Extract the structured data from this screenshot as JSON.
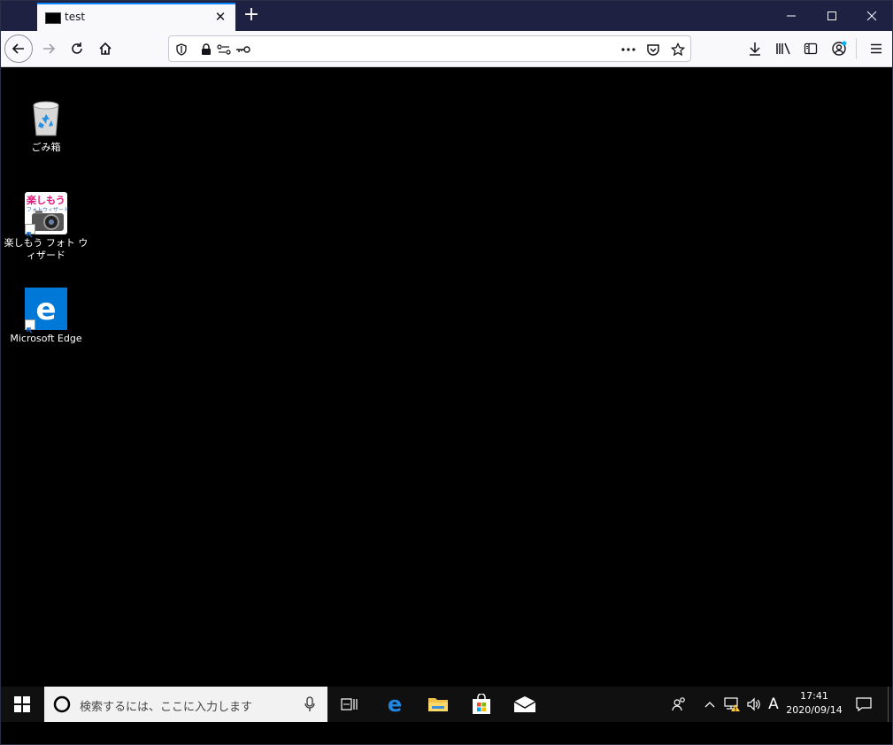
{
  "browser": {
    "tab": {
      "title": "test"
    },
    "url": {
      "text": ""
    }
  },
  "desktop": {
    "icons": [
      {
        "label": "ごみ箱"
      },
      {
        "label": "楽しもう フォト ウィザード"
      },
      {
        "label": "Microsoft Edge"
      }
    ],
    "photo_icon_text": {
      "line1": "楽しもう",
      "line2": "フォトウィザード"
    }
  },
  "taskbar": {
    "search_placeholder": "検索するには、ここに入力します",
    "ime_indicator": "A",
    "time": "17:41",
    "date": "2020/09/14"
  },
  "colors": {
    "titlebar": "#1f2142",
    "accent": "#0a84ff",
    "edge_blue": "#0078d7",
    "desktop_bg": "#000000",
    "taskbar_bg": "#101010"
  }
}
